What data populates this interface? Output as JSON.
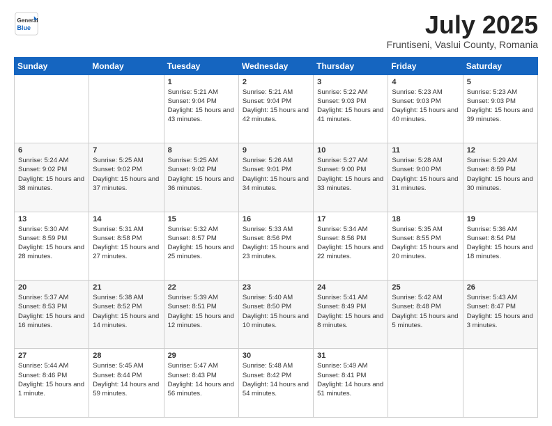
{
  "header": {
    "logo_general": "General",
    "logo_blue": "Blue",
    "month": "July 2025",
    "location": "Fruntiseni, Vaslui County, Romania"
  },
  "weekdays": [
    "Sunday",
    "Monday",
    "Tuesday",
    "Wednesday",
    "Thursday",
    "Friday",
    "Saturday"
  ],
  "weeks": [
    [
      {
        "day": "",
        "sunrise": "",
        "sunset": "",
        "daylight": ""
      },
      {
        "day": "",
        "sunrise": "",
        "sunset": "",
        "daylight": ""
      },
      {
        "day": "1",
        "sunrise": "Sunrise: 5:21 AM",
        "sunset": "Sunset: 9:04 PM",
        "daylight": "Daylight: 15 hours and 43 minutes."
      },
      {
        "day": "2",
        "sunrise": "Sunrise: 5:21 AM",
        "sunset": "Sunset: 9:04 PM",
        "daylight": "Daylight: 15 hours and 42 minutes."
      },
      {
        "day": "3",
        "sunrise": "Sunrise: 5:22 AM",
        "sunset": "Sunset: 9:03 PM",
        "daylight": "Daylight: 15 hours and 41 minutes."
      },
      {
        "day": "4",
        "sunrise": "Sunrise: 5:23 AM",
        "sunset": "Sunset: 9:03 PM",
        "daylight": "Daylight: 15 hours and 40 minutes."
      },
      {
        "day": "5",
        "sunrise": "Sunrise: 5:23 AM",
        "sunset": "Sunset: 9:03 PM",
        "daylight": "Daylight: 15 hours and 39 minutes."
      }
    ],
    [
      {
        "day": "6",
        "sunrise": "Sunrise: 5:24 AM",
        "sunset": "Sunset: 9:02 PM",
        "daylight": "Daylight: 15 hours and 38 minutes."
      },
      {
        "day": "7",
        "sunrise": "Sunrise: 5:25 AM",
        "sunset": "Sunset: 9:02 PM",
        "daylight": "Daylight: 15 hours and 37 minutes."
      },
      {
        "day": "8",
        "sunrise": "Sunrise: 5:25 AM",
        "sunset": "Sunset: 9:02 PM",
        "daylight": "Daylight: 15 hours and 36 minutes."
      },
      {
        "day": "9",
        "sunrise": "Sunrise: 5:26 AM",
        "sunset": "Sunset: 9:01 PM",
        "daylight": "Daylight: 15 hours and 34 minutes."
      },
      {
        "day": "10",
        "sunrise": "Sunrise: 5:27 AM",
        "sunset": "Sunset: 9:00 PM",
        "daylight": "Daylight: 15 hours and 33 minutes."
      },
      {
        "day": "11",
        "sunrise": "Sunrise: 5:28 AM",
        "sunset": "Sunset: 9:00 PM",
        "daylight": "Daylight: 15 hours and 31 minutes."
      },
      {
        "day": "12",
        "sunrise": "Sunrise: 5:29 AM",
        "sunset": "Sunset: 8:59 PM",
        "daylight": "Daylight: 15 hours and 30 minutes."
      }
    ],
    [
      {
        "day": "13",
        "sunrise": "Sunrise: 5:30 AM",
        "sunset": "Sunset: 8:59 PM",
        "daylight": "Daylight: 15 hours and 28 minutes."
      },
      {
        "day": "14",
        "sunrise": "Sunrise: 5:31 AM",
        "sunset": "Sunset: 8:58 PM",
        "daylight": "Daylight: 15 hours and 27 minutes."
      },
      {
        "day": "15",
        "sunrise": "Sunrise: 5:32 AM",
        "sunset": "Sunset: 8:57 PM",
        "daylight": "Daylight: 15 hours and 25 minutes."
      },
      {
        "day": "16",
        "sunrise": "Sunrise: 5:33 AM",
        "sunset": "Sunset: 8:56 PM",
        "daylight": "Daylight: 15 hours and 23 minutes."
      },
      {
        "day": "17",
        "sunrise": "Sunrise: 5:34 AM",
        "sunset": "Sunset: 8:56 PM",
        "daylight": "Daylight: 15 hours and 22 minutes."
      },
      {
        "day": "18",
        "sunrise": "Sunrise: 5:35 AM",
        "sunset": "Sunset: 8:55 PM",
        "daylight": "Daylight: 15 hours and 20 minutes."
      },
      {
        "day": "19",
        "sunrise": "Sunrise: 5:36 AM",
        "sunset": "Sunset: 8:54 PM",
        "daylight": "Daylight: 15 hours and 18 minutes."
      }
    ],
    [
      {
        "day": "20",
        "sunrise": "Sunrise: 5:37 AM",
        "sunset": "Sunset: 8:53 PM",
        "daylight": "Daylight: 15 hours and 16 minutes."
      },
      {
        "day": "21",
        "sunrise": "Sunrise: 5:38 AM",
        "sunset": "Sunset: 8:52 PM",
        "daylight": "Daylight: 15 hours and 14 minutes."
      },
      {
        "day": "22",
        "sunrise": "Sunrise: 5:39 AM",
        "sunset": "Sunset: 8:51 PM",
        "daylight": "Daylight: 15 hours and 12 minutes."
      },
      {
        "day": "23",
        "sunrise": "Sunrise: 5:40 AM",
        "sunset": "Sunset: 8:50 PM",
        "daylight": "Daylight: 15 hours and 10 minutes."
      },
      {
        "day": "24",
        "sunrise": "Sunrise: 5:41 AM",
        "sunset": "Sunset: 8:49 PM",
        "daylight": "Daylight: 15 hours and 8 minutes."
      },
      {
        "day": "25",
        "sunrise": "Sunrise: 5:42 AM",
        "sunset": "Sunset: 8:48 PM",
        "daylight": "Daylight: 15 hours and 5 minutes."
      },
      {
        "day": "26",
        "sunrise": "Sunrise: 5:43 AM",
        "sunset": "Sunset: 8:47 PM",
        "daylight": "Daylight: 15 hours and 3 minutes."
      }
    ],
    [
      {
        "day": "27",
        "sunrise": "Sunrise: 5:44 AM",
        "sunset": "Sunset: 8:46 PM",
        "daylight": "Daylight: 15 hours and 1 minute."
      },
      {
        "day": "28",
        "sunrise": "Sunrise: 5:45 AM",
        "sunset": "Sunset: 8:44 PM",
        "daylight": "Daylight: 14 hours and 59 minutes."
      },
      {
        "day": "29",
        "sunrise": "Sunrise: 5:47 AM",
        "sunset": "Sunset: 8:43 PM",
        "daylight": "Daylight: 14 hours and 56 minutes."
      },
      {
        "day": "30",
        "sunrise": "Sunrise: 5:48 AM",
        "sunset": "Sunset: 8:42 PM",
        "daylight": "Daylight: 14 hours and 54 minutes."
      },
      {
        "day": "31",
        "sunrise": "Sunrise: 5:49 AM",
        "sunset": "Sunset: 8:41 PM",
        "daylight": "Daylight: 14 hours and 51 minutes."
      },
      {
        "day": "",
        "sunrise": "",
        "sunset": "",
        "daylight": ""
      },
      {
        "day": "",
        "sunrise": "",
        "sunset": "",
        "daylight": ""
      }
    ]
  ]
}
